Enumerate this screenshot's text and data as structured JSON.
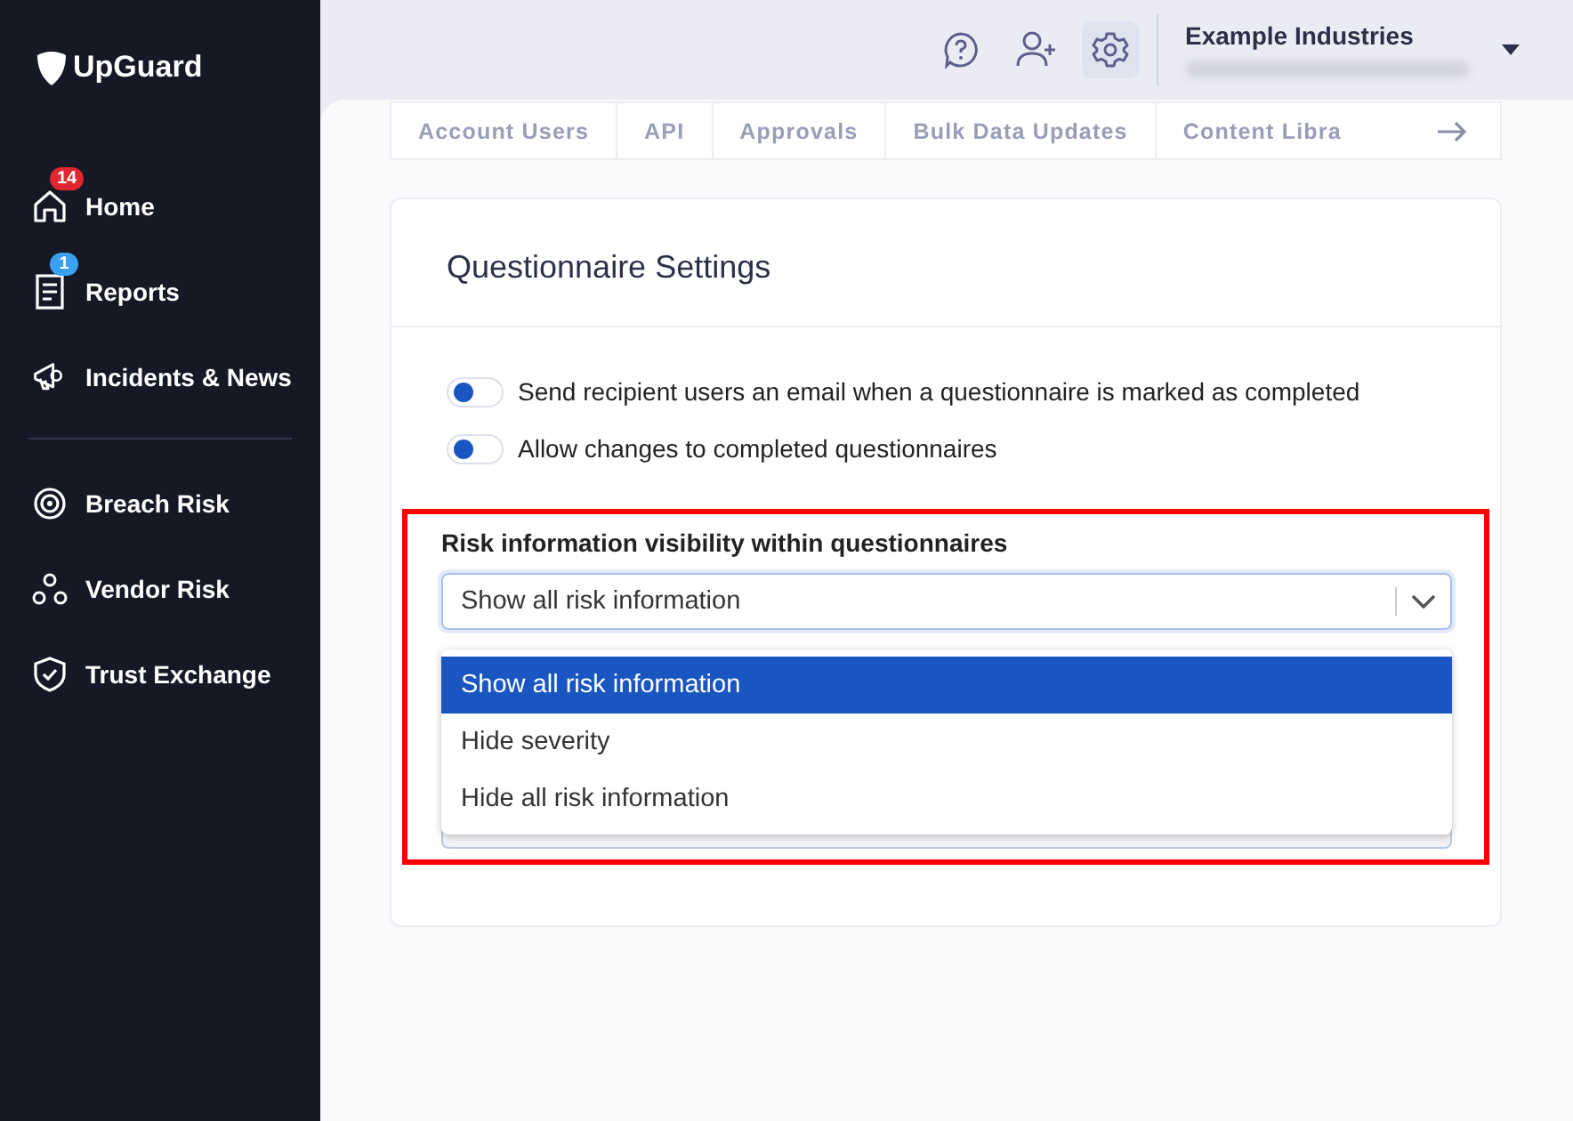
{
  "sidebar": {
    "logo": "UpGuard",
    "items": [
      {
        "label": "Home",
        "badge": "14",
        "color": "#e0262f"
      },
      {
        "label": "Reports",
        "badge": "1",
        "color": "#3aa0f2"
      },
      {
        "label": "Incidents & News"
      },
      {
        "label": "Breach Risk"
      },
      {
        "label": "Vendor Risk"
      },
      {
        "label": "Trust Exchange"
      }
    ]
  },
  "header": {
    "org_name": "Example Industries",
    "settings_selected": true
  },
  "tabs": [
    {
      "label": "Account Users",
      "selected": false
    },
    {
      "label": "API",
      "selected": false
    },
    {
      "label": "Approvals",
      "selected": false
    },
    {
      "label": "Bulk Data Updates",
      "selected": false
    },
    {
      "label": "Content Libra",
      "selected": false
    }
  ],
  "card": {
    "title": "Questionnaire Settings",
    "toggles": [
      {
        "label": "Send recipient users an email when a questionnaire is marked as completed",
        "on": false
      },
      {
        "label": "Allow changes to completed questionnaires",
        "on": false
      }
    ],
    "select": {
      "label": "Risk information visibility within questionnaires",
      "value": "Show all risk information",
      "expanded": true,
      "options": [
        {
          "label": "Show all risk information",
          "selected": true
        },
        {
          "label": "Hide severity",
          "selected": false
        },
        {
          "label": "Hide all risk information",
          "selected": false
        }
      ]
    },
    "highlighted": true
  }
}
